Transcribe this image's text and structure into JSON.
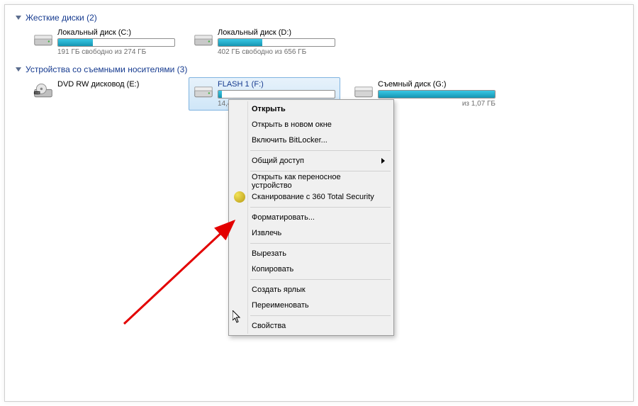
{
  "groups": {
    "hdd": {
      "label": "Жесткие диски",
      "count": "(2)"
    },
    "removable": {
      "label": "Устройства со съемными носителями",
      "count": "(3)"
    }
  },
  "drives": {
    "c": {
      "name": "Локальный диск (C:)",
      "status": "191 ГБ свободно из 274 ГБ",
      "fill": 30
    },
    "d": {
      "name": "Локальный диск (D:)",
      "status": "402 ГБ свободно из 656 ГБ",
      "fill": 38
    },
    "dvd": {
      "name": "DVD RW дисковод (E:)"
    },
    "flash": {
      "name": "FLASH 1 (F:)",
      "status": "14,4 ГБ св",
      "fill": 3
    },
    "g": {
      "name": "Съемный диск (G:)",
      "status": "из 1,07 ГБ",
      "fill": 100
    }
  },
  "ctx": {
    "open": "Открыть",
    "open_new": "Открыть в новом окне",
    "bitlocker": "Включить BitLocker...",
    "share": "Общий доступ",
    "portable": "Открыть как переносное устройство",
    "scan": "Сканирование с 360 Total Security",
    "format": "Форматировать...",
    "eject": "Извлечь",
    "cut": "Вырезать",
    "copy": "Копировать",
    "shortcut": "Создать ярлык",
    "rename": "Переименовать",
    "props": "Свойства"
  }
}
